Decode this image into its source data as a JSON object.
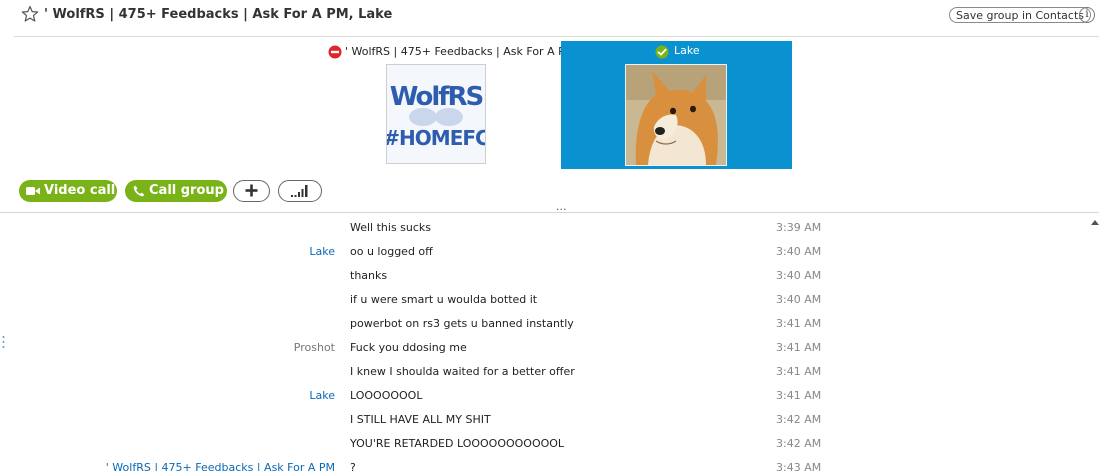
{
  "header": {
    "title": "' WolfRS | 475+ Feedbacks | Ask For A PM, Lake",
    "save_label": "Save group in Contacts",
    "info_label": "i"
  },
  "participants": [
    {
      "name": "' WolfRS | 475+ Feedbacks | Ask For A PM",
      "status": "do-not-disturb",
      "avatar_text": [
        "WolfRS",
        "#HOMEFC"
      ]
    },
    {
      "name": "Lake",
      "status": "online",
      "selected": true
    }
  ],
  "call_controls": {
    "video_call_label": "Video call",
    "call_group_label": "Call group"
  },
  "colors": {
    "accent_green": "#7ab317",
    "selected_blue": "#0a92d0",
    "sender_blue": "#0b68b4"
  },
  "messages": [
    {
      "sender": "",
      "text": "Well this sucks",
      "time": "3:39 AM"
    },
    {
      "sender": "Lake",
      "text": "oo u logged off",
      "time": "3:40 AM"
    },
    {
      "sender": "",
      "text": "thanks",
      "time": "3:40 AM"
    },
    {
      "sender": "",
      "text": "if u were smart u woulda botted it",
      "time": "3:40 AM"
    },
    {
      "sender": "",
      "text": "powerbot on rs3 gets u banned instantly",
      "time": "3:41 AM"
    },
    {
      "sender": "Proshot",
      "text": "Fuck you ddosing me",
      "time": "3:41 AM"
    },
    {
      "sender": "",
      "text": "I knew I shoulda waited for a better offer",
      "time": "3:41 AM"
    },
    {
      "sender": "Lake",
      "text": "LOOOOOOOL",
      "time": "3:41 AM"
    },
    {
      "sender": "",
      "text": "I STILL HAVE ALL MY SHIT",
      "time": "3:42 AM"
    },
    {
      "sender": "",
      "text": "YOU'RE RETARDED LOOOOOOOOOOOL",
      "time": "3:42 AM"
    },
    {
      "sender": "' WolfRS | 475+ Feedbacks | Ask For A PM",
      "text": "?",
      "time": "3:43 AM"
    }
  ]
}
